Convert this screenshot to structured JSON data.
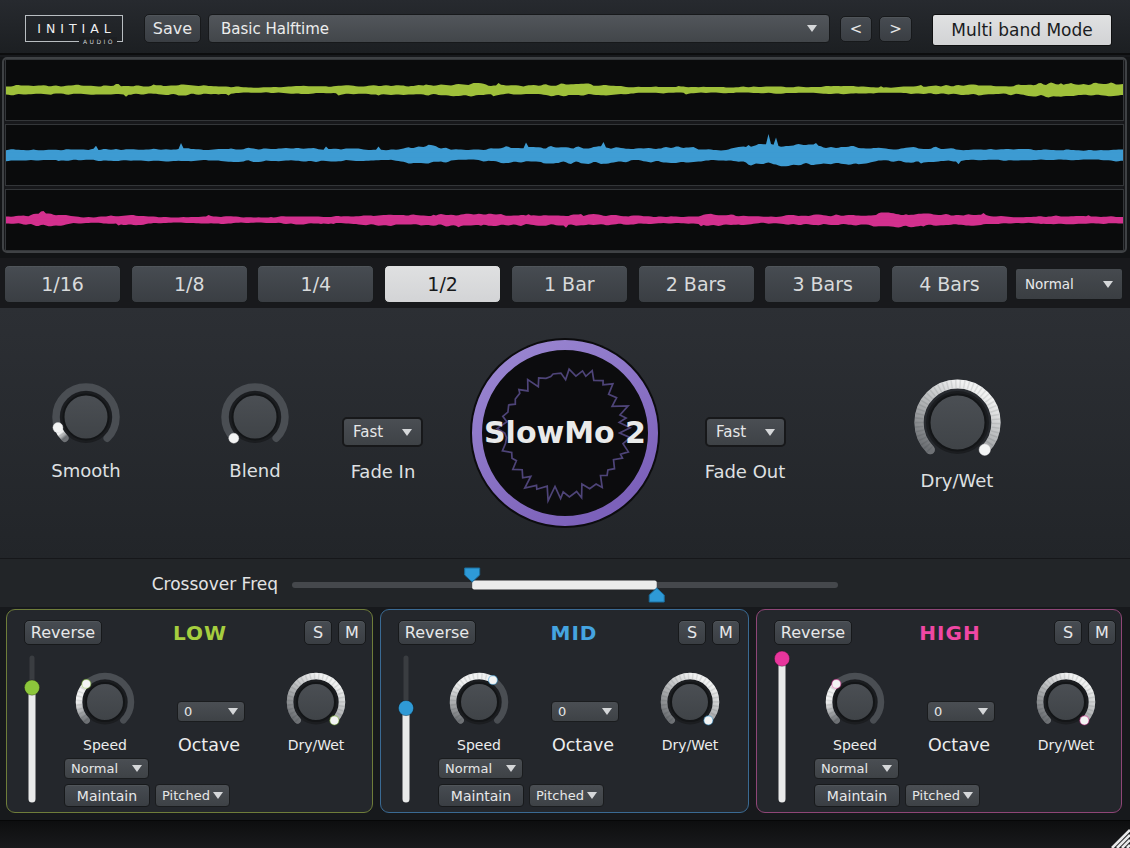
{
  "colors": {
    "accent_purple": "#8a74c6",
    "knob_track": "#4a4e53",
    "knob_lit_start": "#6e7175",
    "knob_lit_end": "#f1f2f2",
    "knob_face_light": "#4b4f54",
    "knob_face_dark": "#3f4347",
    "crossover_handle": "#2e9ad7",
    "crossover_track": "#45484c",
    "crossover_lit": "#ebecec"
  },
  "header": {
    "logo_primary": "INITIAL",
    "logo_secondary": "AUDIO",
    "save_label": "Save",
    "preset_value": "Basic Halftime",
    "prev_label": "<",
    "next_label": ">",
    "multiband_label": "Multi band Mode"
  },
  "waveforms": [
    {
      "band": "low",
      "color": "#9fc03b",
      "seed": 11,
      "amp": 9.0,
      "base": 3.0,
      "spike": 0.5
    },
    {
      "band": "mid",
      "color": "#3d9bd2",
      "seed": 29,
      "amp": 14.5,
      "base": 6.0,
      "spike": 1.0
    },
    {
      "band": "high",
      "color": "#d3308e",
      "seed": 53,
      "amp": 9.5,
      "base": 3.4,
      "spike": 0.5
    }
  ],
  "divisions": {
    "buttons": [
      "1/16",
      "1/8",
      "1/4",
      "1/2",
      "1 Bar",
      "2 Bars",
      "3 Bars",
      "4 Bars"
    ],
    "selected_index": 3,
    "mode_value": "Normal"
  },
  "main": {
    "badge_title": "SlowMo 2",
    "smooth": {
      "label": "Smooth",
      "value": 0.09
    },
    "blend": {
      "label": "Blend",
      "value": 0.0
    },
    "fade_in": {
      "label": "Fade In",
      "value": "Fast"
    },
    "fade_out": {
      "label": "Fade Out",
      "value": "Fast"
    },
    "dry_wet": {
      "label": "Dry/Wet",
      "value": 1.0
    }
  },
  "crossover": {
    "label": "Crossover Freq",
    "low_handle": 0.33,
    "high_handle": 0.668
  },
  "bands": [
    {
      "title": "LOW",
      "reverse_label": "Reverse",
      "solo_label": "S",
      "mute_label": "M",
      "accent_title": "#a6ce3f",
      "accent_border": "#6f7d3a",
      "accent_handle": "#8cc63b",
      "level": 0.79,
      "speed": {
        "label": "Speed",
        "value": 0.33
      },
      "octave": {
        "label": "Octave",
        "value": "0"
      },
      "dry_wet": {
        "label": "Dry/Wet",
        "value": 1.0
      },
      "mode_value": "Normal",
      "maintain_label": "Maintain",
      "pitch_value": "Pitched"
    },
    {
      "title": "MID",
      "reverse_label": "Reverse",
      "solo_label": "S",
      "mute_label": "M",
      "accent_title": "#45a4e0",
      "accent_border": "#3a6a93",
      "accent_handle": "#2f9ad6",
      "level": 0.645,
      "speed": {
        "label": "Speed",
        "value": 0.62
      },
      "octave": {
        "label": "Octave",
        "value": "0"
      },
      "dry_wet": {
        "label": "Dry/Wet",
        "value": 1.0
      },
      "mode_value": "Normal",
      "maintain_label": "Maintain",
      "pitch_value": "Pitched"
    },
    {
      "title": "HIGH",
      "reverse_label": "Reverse",
      "solo_label": "S",
      "mute_label": "M",
      "accent_title": "#ef47a4",
      "accent_border": "#8f4677",
      "accent_handle": "#e8359c",
      "level": 0.995,
      "speed": {
        "label": "Speed",
        "value": 0.33
      },
      "octave": {
        "label": "Octave",
        "value": "0"
      },
      "dry_wet": {
        "label": "Dry/Wet",
        "value": 1.0
      },
      "mode_value": "Normal",
      "maintain_label": "Maintain",
      "pitch_value": "Pitched"
    }
  ]
}
